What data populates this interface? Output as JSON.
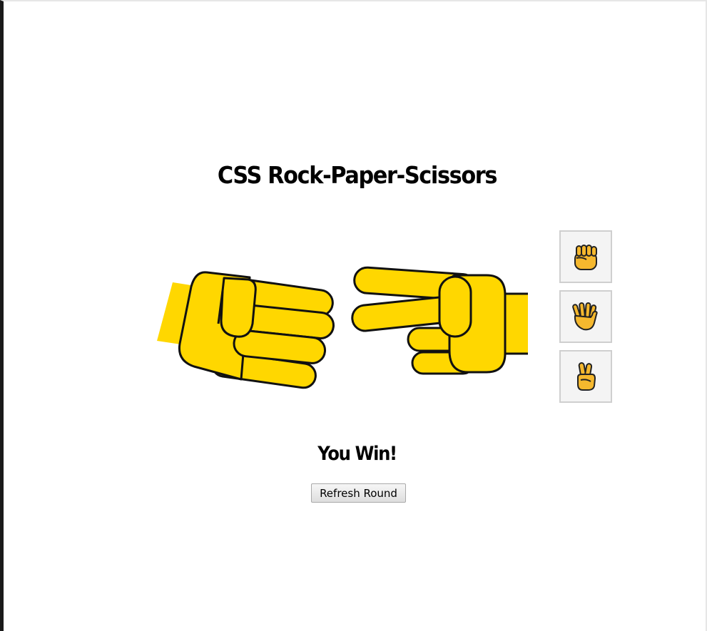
{
  "page": {
    "title": "CSS Rock-Paper-Scissors"
  },
  "game": {
    "player_hand": "paper",
    "computer_hand": "scissors",
    "result": "You Win!"
  },
  "choices": [
    {
      "name": "rock",
      "icon": "raised-fist-icon"
    },
    {
      "name": "paper",
      "icon": "raised-hand-fingers-splayed-icon"
    },
    {
      "name": "scissors",
      "icon": "victory-hand-icon"
    }
  ],
  "controls": {
    "refresh_label": "Refresh Round"
  },
  "colors": {
    "hand_fill": "#ffd700",
    "outline": "#111111",
    "emoji_fill": "#f5b82e"
  }
}
